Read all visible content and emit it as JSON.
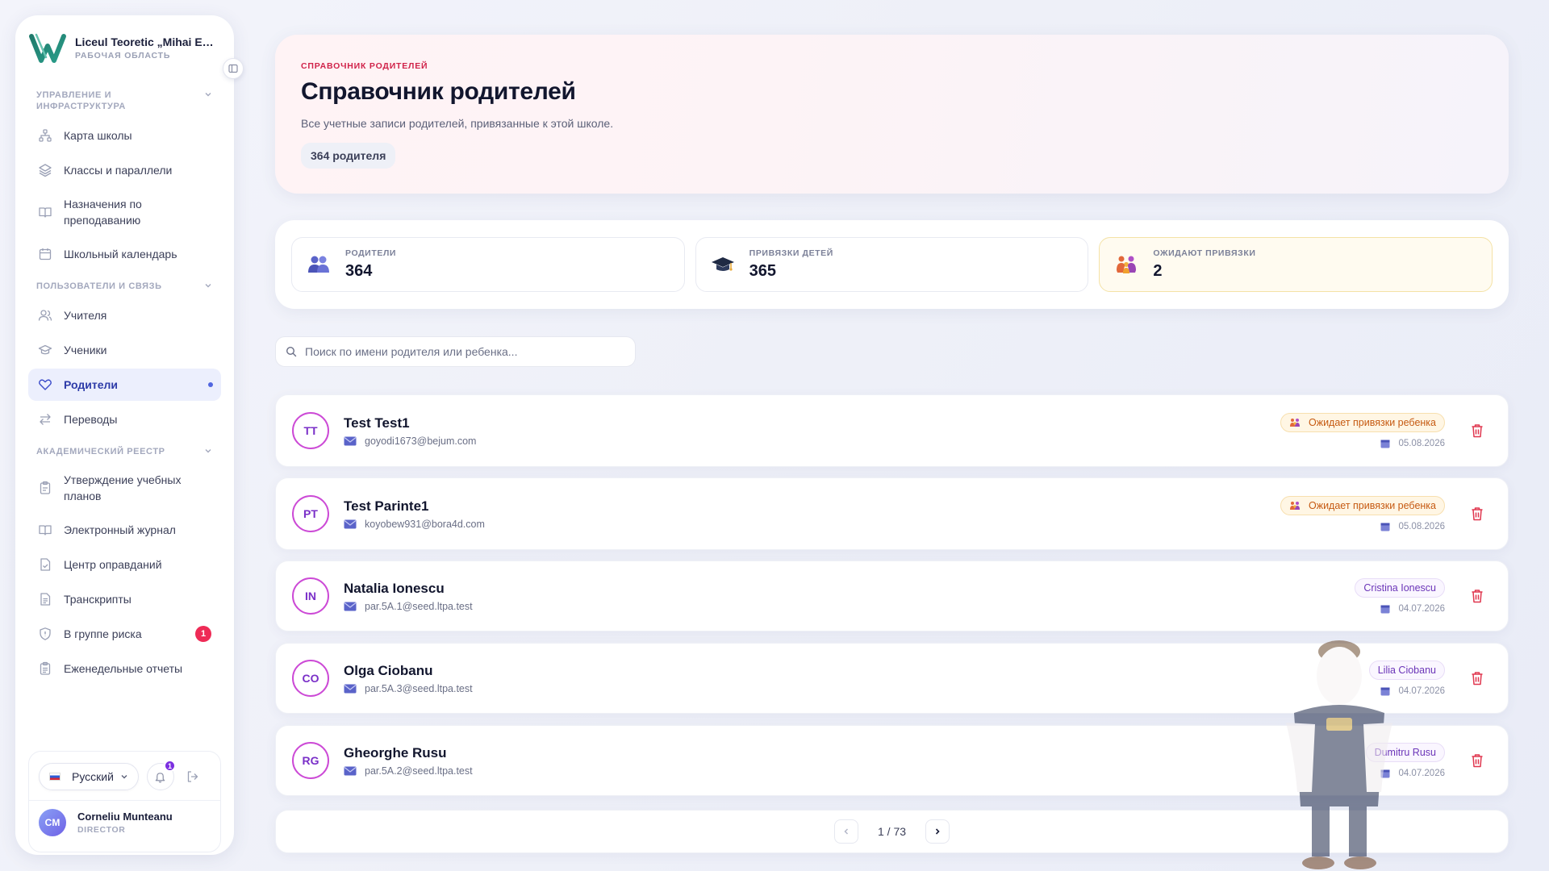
{
  "school": {
    "name": "Liceul Teoretic „Mihai Emi...",
    "workspace_label": "РАБОЧАЯ ОБЛАСТЬ"
  },
  "sidebar": {
    "sections": [
      {
        "label": "УПРАВЛЕНИЕ И ИНФРАСТРУКТУРА"
      },
      {
        "label": "ПОЛЬЗОВАТЕЛИ И СВЯЗЬ"
      },
      {
        "label": "АКАДЕМИЧЕСКИЙ РЕЕСТР"
      }
    ],
    "items": [
      {
        "label": "Карта школы",
        "icon": "sitemap-icon"
      },
      {
        "label": "Классы и параллели",
        "icon": "layers-icon"
      },
      {
        "label": "Назначения по преподаванию",
        "icon": "book-icon"
      },
      {
        "label": "Школьный календарь",
        "icon": "calendar-icon"
      },
      {
        "label": "Учителя",
        "icon": "users-icon"
      },
      {
        "label": "Ученики",
        "icon": "graduation-cap-icon"
      },
      {
        "label": "Родители",
        "icon": "heart-icon",
        "active": true
      },
      {
        "label": "Переводы",
        "icon": "transfer-icon"
      },
      {
        "label": "Утверждение учебных планов",
        "icon": "clipboard-icon"
      },
      {
        "label": "Электронный журнал",
        "icon": "book-open-icon"
      },
      {
        "label": "Центр оправданий",
        "icon": "file-check-icon"
      },
      {
        "label": "Транскрипты",
        "icon": "file-text-icon"
      },
      {
        "label": "В группе риска",
        "icon": "shield-icon",
        "badge": "1"
      },
      {
        "label": "Еженедельные отчеты",
        "icon": "clipboard-list-icon"
      }
    ],
    "accent_color": "#3b4cca",
    "risk_badge_color": "#ee2b56"
  },
  "footer": {
    "language": "Русский",
    "notifications_count": "1",
    "user": {
      "initials": "CM",
      "name": "Corneliu Munteanu",
      "role": "DIRECTOR"
    }
  },
  "hero": {
    "eyebrow": "СПРАВОЧНИК РОДИТЕЛЕЙ",
    "title": "Справочник родителей",
    "description": "Все учетные записи родителей, привязанные к этой школе.",
    "count_pill": "364 родителя"
  },
  "stats": [
    {
      "label": "РОДИТЕЛИ",
      "value": "364",
      "icon": "parents-icon"
    },
    {
      "label": "ПРИВЯЗКИ ДЕТЕЙ",
      "value": "365",
      "icon": "graduation-cap-icon"
    },
    {
      "label": "ОЖИДАЮТ ПРИВЯЗКИ",
      "value": "2",
      "icon": "family-icon",
      "highlight_color": "#fffbf0"
    }
  ],
  "search": {
    "placeholder": "Поиск по имени родителя или ребенка..."
  },
  "parents": [
    {
      "initials": "TT",
      "name": "Test Test1",
      "email": "goyodi1673@bejum.com",
      "status": "Ожидает привязки ребенка",
      "date": "05.08.2026"
    },
    {
      "initials": "PT",
      "name": "Test Parinte1",
      "email": "koyobew931@bora4d.com",
      "status": "Ожидает привязки ребенка",
      "date": "05.08.2026"
    },
    {
      "initials": "IN",
      "name": "Natalia Ionescu",
      "email": "par.5A.1@seed.ltpa.test",
      "child": "Cristina Ionescu",
      "date": "04.07.2026"
    },
    {
      "initials": "CO",
      "name": "Olga Ciobanu",
      "email": "par.5A.3@seed.ltpa.test",
      "child": "Lilia Ciobanu",
      "date": "04.07.2026"
    },
    {
      "initials": "RG",
      "name": "Gheorghe Rusu",
      "email": "par.5A.2@seed.ltpa.test",
      "child": "Dumitru Rusu",
      "date": "04.07.2026"
    }
  ],
  "pagination": {
    "text": "1 / 73"
  }
}
